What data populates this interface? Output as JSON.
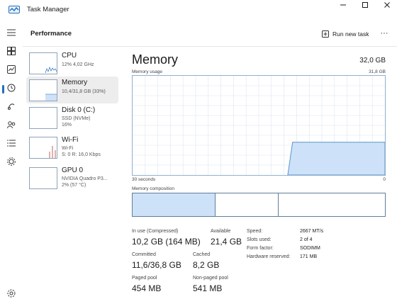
{
  "app": {
    "title": "Task Manager"
  },
  "window_controls": {
    "minimize": "—",
    "maximize": "☐",
    "close": "✕"
  },
  "header": {
    "title": "Performance",
    "run_task": "Run new task",
    "more": "···"
  },
  "rail": {
    "items": [
      {
        "name": "hamburger-menu-icon"
      },
      {
        "name": "processes-icon"
      },
      {
        "name": "performance-icon"
      },
      {
        "name": "app-history-icon"
      },
      {
        "name": "startup-apps-icon"
      },
      {
        "name": "users-icon"
      },
      {
        "name": "details-icon"
      },
      {
        "name": "services-icon"
      },
      {
        "name": "settings-icon"
      }
    ],
    "active": "performance-icon"
  },
  "devices": [
    {
      "name": "CPU",
      "lines": [
        "12% 4,02 GHz"
      ],
      "selected": false
    },
    {
      "name": "Memory",
      "lines": [
        "10,4/31,8 GB (33%)"
      ],
      "selected": true
    },
    {
      "name": "Disk 0 (C:)",
      "lines": [
        "SSD (NVMe)",
        "16%"
      ],
      "selected": false
    },
    {
      "name": "Wi-Fi",
      "lines": [
        "Wi-Fi",
        "S: 0 R: 16,0 Kbps"
      ],
      "selected": false
    },
    {
      "name": "GPU 0",
      "lines": [
        "NVIDIA Quadro P3...",
        "2% (57 °C)"
      ],
      "selected": false
    }
  ],
  "memory": {
    "title": "Memory",
    "total": "32,0 GB",
    "usage_label": "Memory usage",
    "usage_max": "31,8 GB",
    "axis_left": "30 seconds",
    "axis_right": "0",
    "composition_label": "Memory composition",
    "composition_fractions": {
      "in_use": 0.33,
      "modified": 0.25,
      "standby": 0.42
    },
    "usage_fraction": 0.33,
    "stats": {
      "in_use_label": "In use (Compressed)",
      "in_use_value": "10,2 GB (164 MB)",
      "available_label": "Available",
      "available_value": "21,4 GB",
      "committed_label": "Committed",
      "committed_value": "11,6/36,8 GB",
      "cached_label": "Cached",
      "cached_value": "8,2 GB",
      "paged_label": "Paged pool",
      "paged_value": "454 MB",
      "nonpaged_label": "Non-paged pool",
      "nonpaged_value": "541 MB"
    },
    "details": [
      {
        "label": "Speed:",
        "value": "2667 MT/s"
      },
      {
        "label": "Slots used:",
        "value": "2 of 4"
      },
      {
        "label": "Form factor:",
        "value": "SODIMM"
      },
      {
        "label": "Hardware reserved:",
        "value": "171 MB"
      }
    ]
  },
  "colors": {
    "accent": "#1f6fc1",
    "fill": "#cde2f8",
    "line": "#5d93c9",
    "grid": "#dbe6f0"
  }
}
